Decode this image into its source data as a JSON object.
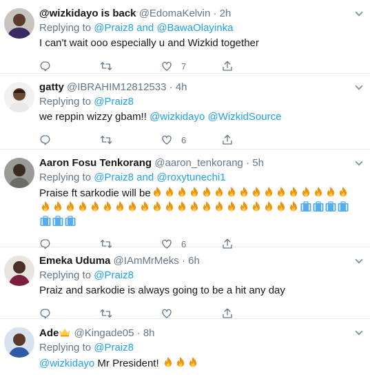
{
  "tweets": [
    {
      "display_name": "@wizkidayo is back",
      "handle": "@EdomaKelvin",
      "time": "2h",
      "replying_prefix": "Replying to",
      "replying_to": "@Praiz8 and @BawaOlayinka",
      "text": "I can't wait ooo especially u and Wizkid together",
      "like_count": "7"
    },
    {
      "display_name": "gatty",
      "handle": "@IBRAHIM12812533",
      "time": "4h",
      "replying_prefix": "Replying to",
      "replying_to": "@Praiz8",
      "text_prefix": "we reppin wizzy gbam!! ",
      "mention1": "@wizkidayo",
      "mention2": "@WizkidSource",
      "like_count": "6"
    },
    {
      "display_name": "Aaron Fosu Tenkorang",
      "handle": "@aaron_tenkorang",
      "time": "5h",
      "replying_prefix": "Replying to",
      "replying_to": "@Praiz8 and @roxytunechi1",
      "text": "Praise ft sarkodie will be",
      "like_count": "6"
    },
    {
      "display_name": "Emeka Uduma",
      "handle": "@IAmMrMeks",
      "time": "6h",
      "replying_prefix": "Replying to",
      "replying_to": "@Praiz8",
      "text": "Praiz and sarkodie is always going to be a hit any day",
      "like_count": ""
    },
    {
      "display_name": "Ade",
      "handle": "@Kingade05",
      "time": "8h",
      "replying_prefix": "Replying to",
      "replying_to": "@Praiz8",
      "mention": "@wizkidayo",
      "text": " Mr President! ",
      "like_count": ""
    }
  ],
  "icons": [
    "reply-icon",
    "retweet-icon",
    "like-icon",
    "share-icon",
    "fire-emoji",
    "rocket-ship-emoji",
    "crown-emoji"
  ],
  "colors": {
    "link": "#1da1f2",
    "muted": "#657786",
    "border": "#e6ecf0"
  }
}
